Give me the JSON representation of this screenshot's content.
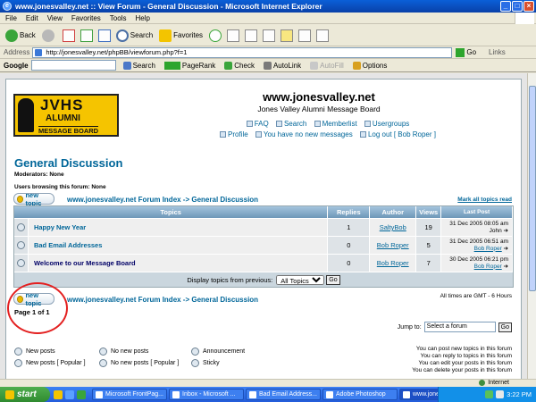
{
  "window": {
    "title": "www.jonesvalley.net :: View Forum - General Discussion - Microsoft Internet Explorer"
  },
  "menu": [
    "File",
    "Edit",
    "View",
    "Favorites",
    "Tools",
    "Help"
  ],
  "toolbar": {
    "back": "Back",
    "search": "Search",
    "favorites": "Favorites"
  },
  "address": {
    "label": "Address",
    "url": "http://jonesvalley.net/phpBB/viewforum.php?f=1",
    "go": "Go",
    "links": "Links"
  },
  "google_bar": {
    "logo": "Google",
    "search": "Search",
    "pagerank": "PageRank",
    "check": "Check",
    "autolink": "AutoLink",
    "autofill": "AutoFill",
    "options": "Options"
  },
  "site": {
    "logo_line1": "JVHS",
    "logo_line2": "ALUMNI",
    "logo_line3": "MESSAGE BOARD",
    "title": "www.jonesvalley.net",
    "description": "Jones Valley Alumni Message Board",
    "nav": {
      "faq": "FAQ",
      "search": "Search",
      "memberlist": "Memberlist",
      "usergroups": "Usergroups",
      "profile": "Profile",
      "messages": "You have no new messages",
      "logout": "Log out [ Bob Roper ]"
    }
  },
  "forum": {
    "title": "General Discussion",
    "moderators": "Moderators: None",
    "browsing": "Users browsing this forum: None",
    "new_topic": "new topic",
    "breadcrumb": "www.jonesvalley.net Forum Index -> General Discussion",
    "mark_read": "Mark all topics read",
    "columns": {
      "topics": "Topics",
      "replies": "Replies",
      "author": "Author",
      "views": "Views",
      "last_post": "Last Post"
    },
    "topics": [
      {
        "title": "Happy New Year",
        "replies": "1",
        "author": "SaltyBob",
        "views": "19",
        "last_date": "31 Dec 2005 08:05 am",
        "last_user": "John"
      },
      {
        "title": "Bad Email Addresses",
        "replies": "0",
        "author": "Bob Roper",
        "views": "5",
        "last_date": "31 Dec 2005 06:51 am",
        "last_user": "Bob Roper"
      },
      {
        "title": "Welcome to our Message Board",
        "replies": "0",
        "author": "Bob Roper",
        "views": "7",
        "last_date": "30 Dec 2005 06:21 pm",
        "last_user": "Bob Roper"
      }
    ],
    "display_label": "Display topics from previous:",
    "display_value": "All Topics",
    "go": "Go",
    "timezone": "All times are GMT - 6 Hours",
    "page_of": "Page 1 of 1",
    "jump_label": "Jump to:",
    "jump_value": "Select a forum",
    "legend": {
      "new_posts": "New posts",
      "no_new_posts": "No new posts",
      "announcement": "Announcement",
      "new_popular": "New posts [ Popular ]",
      "no_new_popular": "No new posts [ Popular ]",
      "sticky": "Sticky"
    },
    "permissions": [
      "You can post new topics in this forum",
      "You can reply to topics in this forum",
      "You can edit your posts in this forum",
      "You can delete your posts in this forum"
    ]
  },
  "status": {
    "zone": "Internet"
  },
  "taskbar": {
    "start": "start",
    "tasks": [
      "Microsoft FrontPag...",
      "Inbox - Microsoft ...",
      "Bad Email Address...",
      "Adobe Photoshop",
      "www.jonesvalley.n..."
    ],
    "clock": "3:22 PM"
  }
}
